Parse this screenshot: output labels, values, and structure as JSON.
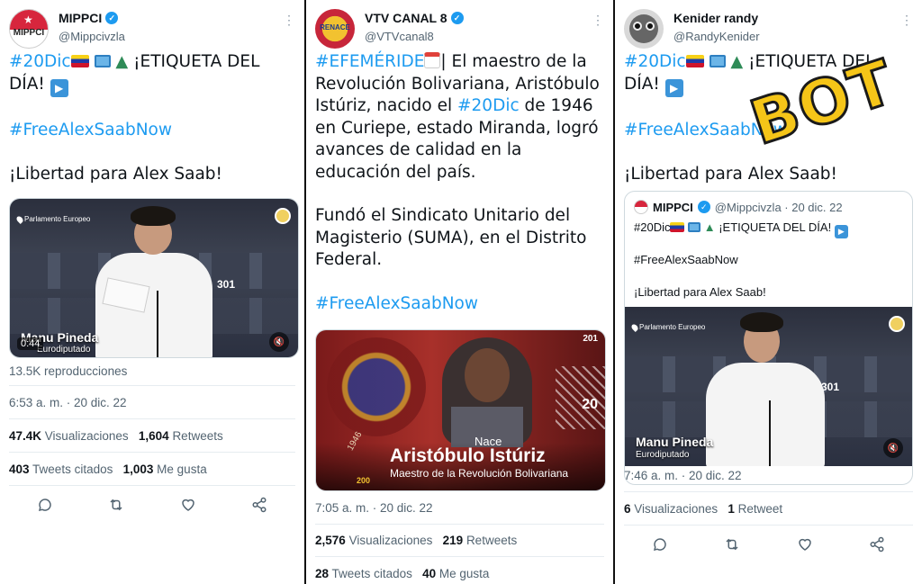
{
  "tweet1": {
    "avatar_text": "MIPPCI",
    "name": "MIPPCI",
    "handle": "@Mippcivzla",
    "hashtag1": "#20Dic",
    "text1_rest": "¡ETIQUETA DEL DÍA!",
    "hashtag2": "#FreeAlexSaabNow",
    "text2": "¡Libertad para Alex Saab!",
    "video": {
      "location": "Parlamento Europeo",
      "name_big": "Manu Pineda",
      "name_small": "Eurodiputado",
      "duration": "0:44",
      "seat_number": "301"
    },
    "views_text": "13.5K reproducciones",
    "timestamp": "6:53 a. m. · 20 dic. 22",
    "visualizations_count": "47.4K",
    "visualizations_label": "Visualizaciones",
    "retweets_count": "1,604",
    "retweets_label": "Retweets",
    "quotes_count": "403",
    "quotes_label": "Tweets citados",
    "likes_count": "1,003",
    "likes_label": "Me gusta"
  },
  "tweet2": {
    "avatar_text": "RENACE",
    "name": "VTV CANAL 8",
    "handle": "@VTVcanal8",
    "hashtag1": "#EFEMÉRIDE",
    "text1": "| El maestro de la Revolución Bolivariana, Aristóbulo Istúriz, nacido el",
    "hashtag_inline": "#20Dic",
    "text1_end": "de 1946 en Curiepe, estado Miranda, logró avances de calidad en la educación del país.",
    "text2": "Fundó el Sindicato Unitario del Magisterio (SUMA), en el Distrito Federal.",
    "hashtag2": "#FreeAlexSaabNow",
    "image": {
      "nace": "Nace",
      "person_name": "Aristóbulo Istúriz",
      "subtitle": "Maestro de la Revolución Bolivariana",
      "year": "1946",
      "badge_top": "201",
      "badge_day": "20",
      "badge_bottom": "200"
    },
    "timestamp": "7:05 a. m. · 20 dic. 22",
    "visualizations_count": "2,576",
    "visualizations_label": "Visualizaciones",
    "retweets_count": "219",
    "retweets_label": "Retweets",
    "quotes_count": "28",
    "quotes_label": "Tweets citados",
    "likes_count": "40",
    "likes_label": "Me gusta"
  },
  "tweet3": {
    "name": "Kenider randy",
    "handle": "@RandyKenider",
    "hashtag1": "#20Dic",
    "text1_rest": "¡ETIQUETA DEL DÍA!",
    "hashtag2": "#FreeAlexSaabNow",
    "text2": "¡Libertad para Alex Saab!",
    "bot_label": "BOT",
    "quoted": {
      "name": "MIPPCI",
      "handle_date": "@Mippcivzla · 20 dic. 22",
      "line1_tag": "#20Dic",
      "line1_rest": "¡ETIQUETA DEL DÍA!",
      "line2": "#FreeAlexSaabNow",
      "line3": "¡Libertad para Alex Saab!",
      "video": {
        "location": "Parlamento Europeo",
        "name_big": "Manu Pineda",
        "name_small": "Eurodiputado",
        "seat_number": "301"
      }
    },
    "timestamp": "7:46 a. m. · 20 dic. 22",
    "visualizations_count": "6",
    "visualizations_label": "Visualizaciones",
    "retweets_count": "1",
    "retweets_label": "Retweet"
  },
  "more_icon": "⋮",
  "colors": {
    "link": "#1d9bf0",
    "muted": "#536471",
    "bot": "#f5c518"
  }
}
